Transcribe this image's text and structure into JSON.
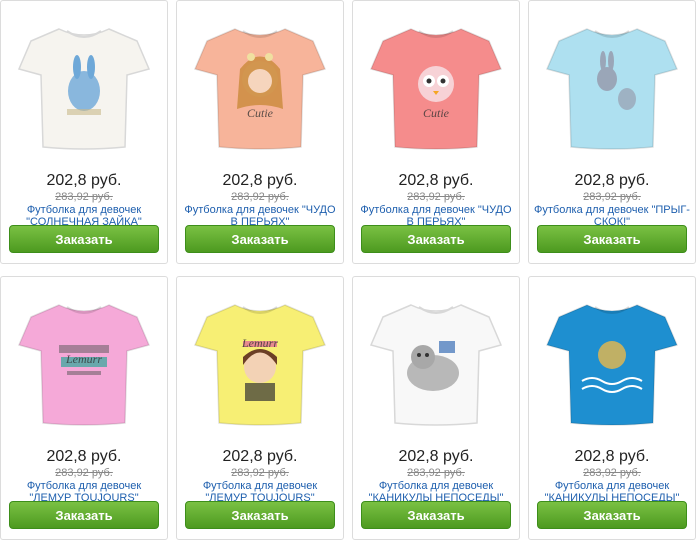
{
  "products": [
    {
      "price": "202,8 руб.",
      "old_price": "283,92 руб.",
      "title": "Футболка для девочек \"СОЛНЕЧНАЯ ЗАЙКА\"",
      "button": "Заказать",
      "shirt_color": "#f6f4ef",
      "print": "bunny-icon",
      "print_text": "",
      "accent": "#6ea8d8"
    },
    {
      "price": "202,8 руб.",
      "old_price": "283,92 руб.",
      "title": "Футболка для девочек \"ЧУДО В ПЕРЬЯХ\"",
      "button": "Заказать",
      "shirt_color": "#f7b49a",
      "print": "girl-portrait-icon",
      "print_text": "Cutie",
      "accent": "#c98a3a"
    },
    {
      "price": "202,8 руб.",
      "old_price": "283,92 руб.",
      "title": "Футболка для девочек \"ЧУДО В ПЕРЬЯХ\"",
      "button": "Заказать",
      "shirt_color": "#f58c8c",
      "print": "owl-icon",
      "print_text": "Cutie",
      "accent": "#f7d2d6"
    },
    {
      "price": "202,8 руб.",
      "old_price": "283,92 руб.",
      "title": "Футболка для девочек \"ПРЫГ-СКОК!\"",
      "button": "Заказать",
      "shirt_color": "#aee0f0",
      "print": "rabbits-icon",
      "print_text": "",
      "accent": "#9aa6b8"
    },
    {
      "price": "202,8 руб.",
      "old_price": "283,92 руб.",
      "title": "Футболка для девочек \"ЛЕМУР TOUJOURS\"",
      "button": "Заказать",
      "shirt_color": "#f5a9d8",
      "print": "lemur-text-icon",
      "print_text": "Lemurr",
      "accent": "#2ea89a"
    },
    {
      "price": "202,8 руб.",
      "old_price": "283,92 руб.",
      "title": "Футболка для девочек \"ЛЕМУР TOUJOURS\"",
      "button": "Заказать",
      "shirt_color": "#f7ef74",
      "print": "girl-headphones-icon",
      "print_text": "Lemurr",
      "accent": "#e0609a"
    },
    {
      "price": "202,8 руб.",
      "old_price": "283,92 руб.",
      "title": "Футболка для девочек \"КАНИКУЛЫ НЕПОСЕДЫ\"",
      "button": "Заказать",
      "shirt_color": "#f8f8f8",
      "print": "cat-icon",
      "print_text": "",
      "accent": "#e8b84a"
    },
    {
      "price": "202,8 руб.",
      "old_price": "283,92 руб.",
      "title": "Футболка для девочек \"КАНИКУЛЫ НЕПОСЕДЫ\"",
      "button": "Заказать",
      "shirt_color": "#1e8fd0",
      "print": "cat-swimming-icon",
      "print_text": "",
      "accent": "#e8b84a"
    }
  ]
}
